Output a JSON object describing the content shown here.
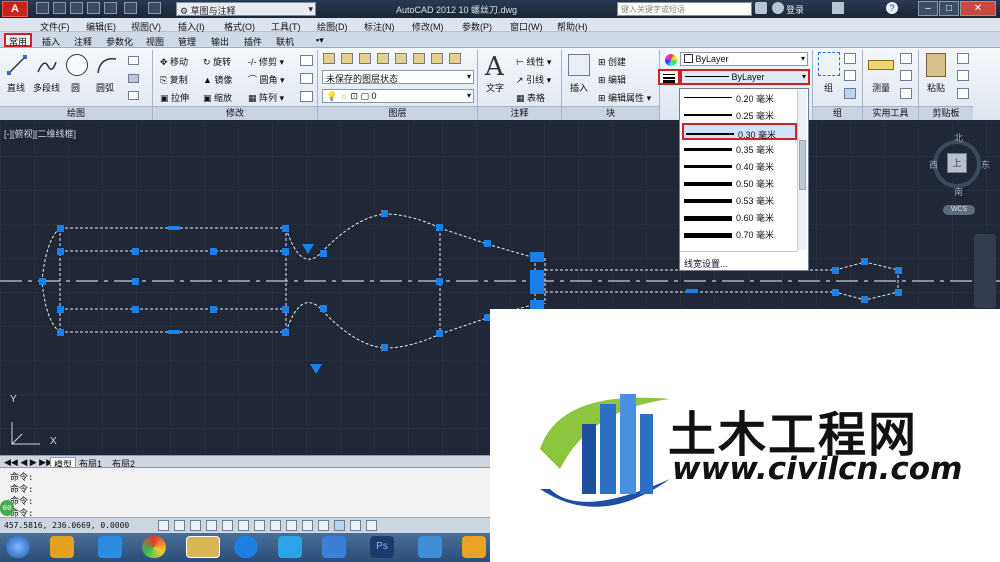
{
  "title_bar": {
    "workspace": "草图与注释",
    "app_title": "AutoCAD 2012    10 螺丝刀.dwg",
    "search_placeholder": "键入关键字或短语",
    "login": "登录"
  },
  "menu": [
    "文件(F)",
    "编辑(E)",
    "视图(V)",
    "插入(I)",
    "格式(O)",
    "工具(T)",
    "绘图(D)",
    "标注(N)",
    "修改(M)",
    "参数(P)",
    "窗口(W)",
    "帮助(H)"
  ],
  "tabs": {
    "active": "常用",
    "others": [
      "插入",
      "注释",
      "参数化",
      "视图",
      "管理",
      "输出",
      "插件",
      "联机"
    ]
  },
  "ribbon": {
    "draw": {
      "line": "直线",
      "polyline": "多段线",
      "circle": "圆",
      "arc": "圆弧",
      "footer": "绘图"
    },
    "modify": {
      "move": "移动",
      "rotate": "旋转",
      "trim": "修剪",
      "copy": "复制",
      "mirror": "镜像",
      "fillet": "圆角",
      "stretch": "拉伸",
      "scale": "缩放",
      "array": "阵列",
      "footer": "修改"
    },
    "layers": {
      "state": "未保存的图层状态",
      "current": "0",
      "footer": "图层"
    },
    "annotation": {
      "text": "文字",
      "linear": "线性",
      "leader": "引线",
      "table": "表格",
      "footer": "注释"
    },
    "block": {
      "insert": "插入",
      "create": "创建",
      "edit": "编辑",
      "edit_attr": "编辑属性",
      "footer": "块"
    },
    "properties": {
      "color": "ByLayer",
      "lineweight": "ByLayer"
    },
    "groups": {
      "group": "组",
      "footer": "组"
    },
    "utilities": {
      "measure": "测量",
      "footer": "实用工具"
    },
    "clipboard": {
      "paste": "粘贴",
      "footer": "剪贴板"
    }
  },
  "viewport": {
    "label": "[-][俯视][二维线框]",
    "compass": {
      "n": "北",
      "s": "南",
      "w": "西",
      "e": "东",
      "center": "上"
    },
    "wcs": "WCS",
    "axis_x": "X",
    "axis_y": "Y"
  },
  "lineweight_dropdown": {
    "items": [
      {
        "label": "0.20 毫米",
        "weight": 1.5
      },
      {
        "label": "0.25 毫米",
        "weight": 1.8
      },
      {
        "label": "0.30 毫米",
        "weight": 2.2,
        "selected": true
      },
      {
        "label": "0.35 毫米",
        "weight": 2.5
      },
      {
        "label": "0.40 毫米",
        "weight": 3
      },
      {
        "label": "0.50 毫米",
        "weight": 3.5
      },
      {
        "label": "0.53 毫米",
        "weight": 4
      },
      {
        "label": "0.60 毫米",
        "weight": 4.5
      },
      {
        "label": "0.70 毫米",
        "weight": 5
      }
    ],
    "settings": "线宽设置..."
  },
  "layout_tabs": [
    "模型",
    "布局1",
    "布局2"
  ],
  "command_lines": [
    "命令:",
    "命令:",
    "命令:",
    "命令:"
  ],
  "coords": "457.5816, 236.0669, 0.0000",
  "logo": {
    "title": "土木工程网",
    "url": "www.civilcn.com"
  },
  "colors": {
    "accent_red": "#d12222",
    "grip_blue": "#1a7fe6",
    "canvas": "#202838"
  }
}
